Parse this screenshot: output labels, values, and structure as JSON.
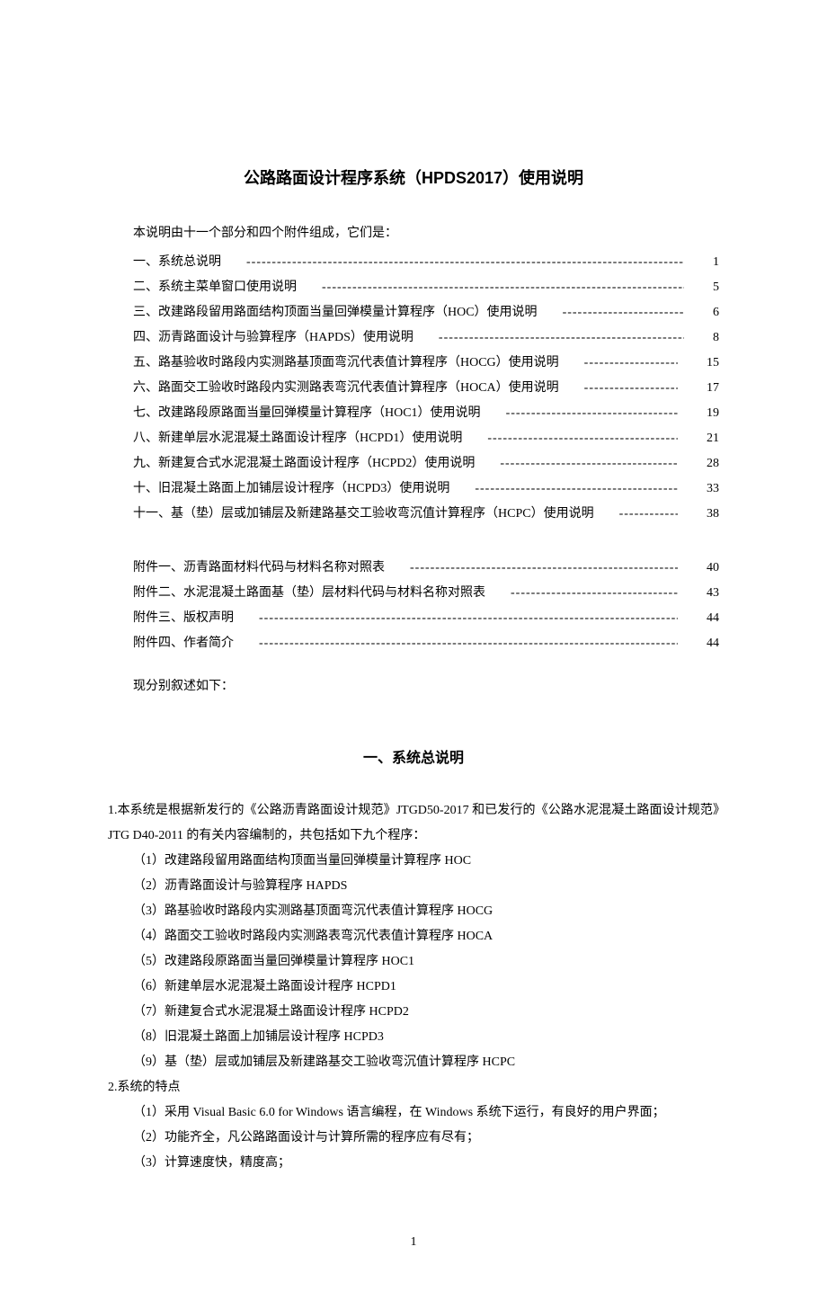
{
  "title": "公路路面设计程序系统（HPDS2017）使用说明",
  "intro": "本说明由十一个部分和四个附件组成，它们是：",
  "toc": [
    {
      "label": "一、系统总说明",
      "page": "1"
    },
    {
      "label": "二、系统主菜单窗口使用说明",
      "page": "5"
    },
    {
      "label": "三、改建路段留用路面结构顶面当量回弹模量计算程序（HOC）使用说明",
      "page": "6"
    },
    {
      "label": "四、沥青路面设计与验算程序（HAPDS）使用说明",
      "page": "8"
    },
    {
      "label": "五、路基验收时路段内实测路基顶面弯沉代表值计算程序（HOCG）使用说明",
      "page": "15"
    },
    {
      "label": "六、路面交工验收时路段内实测路表弯沉代表值计算程序（HOCA）使用说明",
      "page": "17"
    },
    {
      "label": "七、改建路段原路面当量回弹模量计算程序（HOC1）使用说明",
      "page": "19"
    },
    {
      "label": "八、新建单层水泥混凝土路面设计程序（HCPD1）使用说明",
      "page": "21"
    },
    {
      "label": "九、新建复合式水泥混凝土路面设计程序（HCPD2）使用说明",
      "page": "28"
    },
    {
      "label": "十、旧混凝土路面上加铺层设计程序（HCPD3）使用说明",
      "page": "33"
    },
    {
      "label": "十一、基（垫）层或加铺层及新建路基交工验收弯沉值计算程序（HCPC）使用说明",
      "page": "38"
    }
  ],
  "appendix": [
    {
      "label": "附件一、沥青路面材料代码与材料名称对照表",
      "page": "40"
    },
    {
      "label": "附件二、水泥混凝土路面基（垫）层材料代码与材料名称对照表",
      "page": "43"
    },
    {
      "label": "附件三、版权声明",
      "page": "44"
    },
    {
      "label": "附件四、作者简介",
      "page": "44"
    }
  ],
  "closing": "现分别叙述如下：",
  "section1": {
    "title": "一、系统总说明",
    "para1": "1.本系统是根据新发行的《公路沥青路面设计规范》JTGD50-2017 和已发行的《公路水泥混凝土路面设计规范》JTG D40-2011 的有关内容编制的，共包括如下九个程序：",
    "programs": [
      "（1）改建路段留用路面结构顶面当量回弹模量计算程序 HOC",
      "（2）沥青路面设计与验算程序 HAPDS",
      "（3）路基验收时路段内实测路基顶面弯沉代表值计算程序 HOCG",
      "（4）路面交工验收时路段内实测路表弯沉代表值计算程序 HOCA",
      "（5）改建路段原路面当量回弹模量计算程序 HOC1",
      "（6）新建单层水泥混凝土路面设计程序 HCPD1",
      "（7）新建复合式水泥混凝土路面设计程序 HCPD2",
      "（8）旧混凝土路面上加铺层设计程序 HCPD3",
      "（9）基（垫）层或加铺层及新建路基交工验收弯沉值计算程序 HCPC"
    ],
    "para2": "2.系统的特点",
    "features": [
      "（1）采用 Visual Basic 6.0 for Windows 语言编程，在 Windows 系统下运行，有良好的用户界面；",
      "（2）功能齐全，凡公路路面设计与计算所需的程序应有尽有；",
      "（3）计算速度快，精度高；"
    ]
  },
  "pageNumber": "1"
}
